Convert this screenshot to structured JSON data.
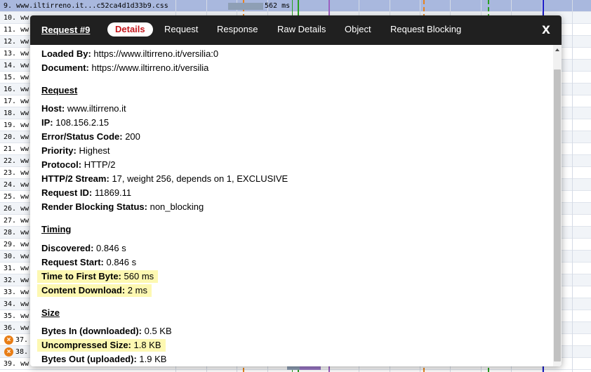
{
  "waterfall": {
    "rows": [
      {
        "label": "9. www.iltirreno.it...c52ca4d1d33b9.css",
        "error": false,
        "selected": true
      },
      {
        "label": "10. ww",
        "error": false
      },
      {
        "label": "11. ww",
        "error": false
      },
      {
        "label": "12. ww",
        "error": false
      },
      {
        "label": "13. ww",
        "error": false
      },
      {
        "label": "14. ww",
        "error": false
      },
      {
        "label": "15. ww",
        "error": false
      },
      {
        "label": "16. ww",
        "error": false
      },
      {
        "label": "17. ww",
        "error": false
      },
      {
        "label": "18. ww",
        "error": false
      },
      {
        "label": "19. ww",
        "error": false
      },
      {
        "label": "20. ww",
        "error": false
      },
      {
        "label": "21. ww",
        "error": false
      },
      {
        "label": "22. ww",
        "error": false
      },
      {
        "label": "23. ww",
        "error": false
      },
      {
        "label": "24. ww",
        "error": false
      },
      {
        "label": "25. ww",
        "error": false
      },
      {
        "label": "26. ww",
        "error": false
      },
      {
        "label": "27. ww",
        "error": false
      },
      {
        "label": "28. ww",
        "error": false
      },
      {
        "label": "29. ww",
        "error": false
      },
      {
        "label": "30. ww",
        "error": false
      },
      {
        "label": "31. ww",
        "error": false
      },
      {
        "label": "32. ww",
        "error": false
      },
      {
        "label": "33. ww",
        "error": false
      },
      {
        "label": "34. ww",
        "error": false
      },
      {
        "label": "35. ww",
        "error": false
      },
      {
        "label": "36. ww",
        "error": false
      },
      {
        "label": "37.",
        "error": true
      },
      {
        "label": "38.",
        "error": true
      },
      {
        "label": "39. ww",
        "error": false
      }
    ],
    "selected_bar_label": "562 ms",
    "error_icon": "x-circle-icon",
    "colors": {
      "dom_interactive": "#e8831c",
      "first_paint": "#2aa01f",
      "dom_content_loaded": "#9b5fc0",
      "onload": "#1c1cc9"
    }
  },
  "dialog": {
    "title": "Request #9",
    "tabs": [
      {
        "label": "Details",
        "active": true
      },
      {
        "label": "Request",
        "active": false
      },
      {
        "label": "Response",
        "active": false
      },
      {
        "label": "Raw Details",
        "active": false
      },
      {
        "label": "Object",
        "active": false
      },
      {
        "label": "Request Blocking",
        "active": false
      }
    ],
    "close_label": "x",
    "top_fields": [
      {
        "label": "Loaded By:",
        "value": "https://www.iltirreno.it/versilia:0"
      },
      {
        "label": "Document:",
        "value": "https://www.iltirreno.it/versilia"
      }
    ],
    "request": {
      "heading": "Request",
      "fields": [
        {
          "label": "Host:",
          "value": "www.iltirreno.it"
        },
        {
          "label": "IP:",
          "value": "108.156.2.15"
        },
        {
          "label": "Error/Status Code:",
          "value": "200"
        },
        {
          "label": "Priority:",
          "value": "Highest"
        },
        {
          "label": "Protocol:",
          "value": "HTTP/2"
        },
        {
          "label": "HTTP/2 Stream:",
          "value": "17, weight 256, depends on 1, EXCLUSIVE"
        },
        {
          "label": "Request ID:",
          "value": "11869.11"
        },
        {
          "label": "Render Blocking Status:",
          "value": "non_blocking"
        }
      ]
    },
    "timing": {
      "heading": "Timing",
      "fields": [
        {
          "label": "Discovered:",
          "value": "0.846 s",
          "highlight": false
        },
        {
          "label": "Request Start:",
          "value": "0.846 s",
          "highlight": false
        },
        {
          "label": "Time to First Byte:",
          "value": "560 ms",
          "highlight": true
        },
        {
          "label": "Content Download:",
          "value": "2 ms",
          "highlight": true
        }
      ]
    },
    "size": {
      "heading": "Size",
      "fields": [
        {
          "label": "Bytes In (downloaded):",
          "value": "0.5 KB",
          "highlight": false
        },
        {
          "label": "Uncompressed Size:",
          "value": "1.8 KB",
          "highlight": true
        },
        {
          "label": "Bytes Out (uploaded):",
          "value": "1.9 KB",
          "highlight": false
        }
      ]
    }
  }
}
